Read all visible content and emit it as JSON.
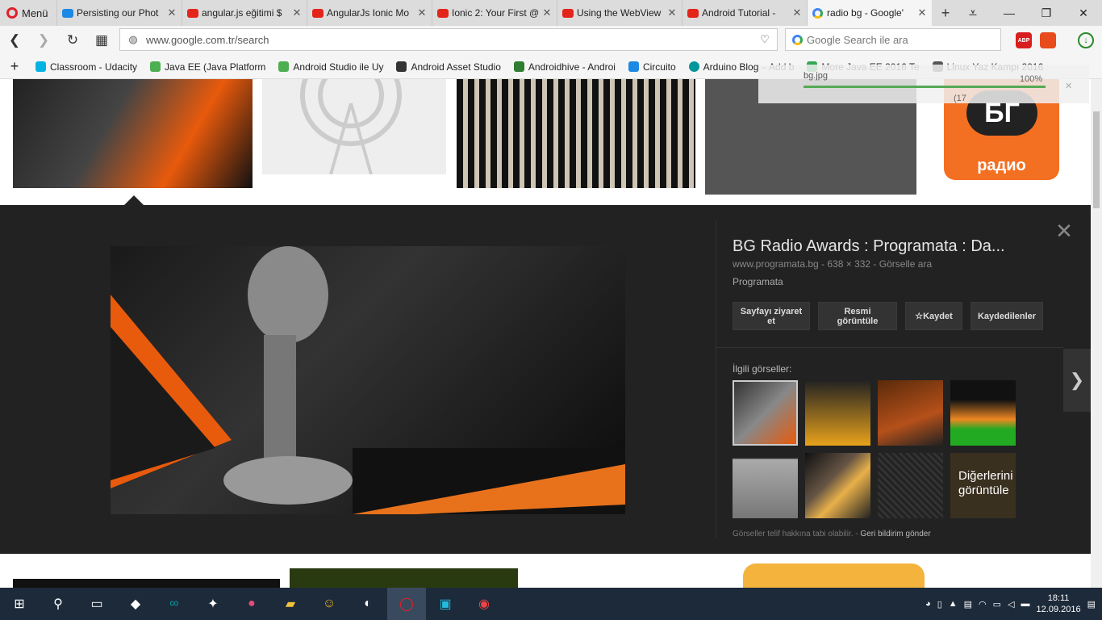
{
  "tabbar": {
    "menu_label": "Menü",
    "tabs": [
      {
        "title": "Persisting our Phot",
        "icon": "udacity-icon"
      },
      {
        "title": "angular.js eğitimi $",
        "icon": "youtube-icon"
      },
      {
        "title": "AngularJs Ionic Mo",
        "icon": "youtube-icon"
      },
      {
        "title": "Ionic 2: Your First @",
        "icon": "youtube-icon"
      },
      {
        "title": "Using the WebView",
        "icon": "youtube-icon"
      },
      {
        "title": "Android Tutorial -",
        "icon": "youtube-icon"
      },
      {
        "title": "radio bg - Google'",
        "icon": "google-icon",
        "active": true
      }
    ]
  },
  "address": {
    "url": "www.google.com.tr/search",
    "search_placeholder": "Google Search ile ara"
  },
  "bookmarks": [
    {
      "label": "Classroom - Udacity",
      "color": "#02b3e4"
    },
    {
      "label": "Java EE (Java Platform",
      "color": "#4caf50"
    },
    {
      "label": "Android Studio ile Uy",
      "color": "#4caf50"
    },
    {
      "label": "Android Asset Studio",
      "color": "#333333"
    },
    {
      "label": "Androidhive - Androi",
      "color": "#2e7d32"
    },
    {
      "label": "Circuito",
      "color": "#1e88e5"
    },
    {
      "label": "Arduino Blog – Add b",
      "color": "#00979c"
    },
    {
      "label": "More Java EE 2016 Te",
      "color": "#34a853"
    },
    {
      "label": "Linux Yaz Kampı 2016",
      "color": "#555555"
    }
  ],
  "download": {
    "file": "bg.jpg",
    "percent": "100%",
    "size": "(17"
  },
  "preview": {
    "title": "BG Radio Awards : Programata : Da...",
    "meta": "www.programata.bg - 638 × 332 - Görselle ara",
    "source": "Programata",
    "buttons": {
      "visit": "Sayfayı ziyaret et",
      "view": "Resmi görüntüle",
      "save": "Kaydet",
      "saved": "Kaydedilenler"
    },
    "related_label": "İlgili görseller:",
    "more_label": "Diğerlerini görüntüle",
    "footer_text": "Görseller telif hakkına tabi olabilir.",
    "footer_link": "Geri bildirim gönder"
  },
  "badge": {
    "line1": "БГ",
    "line2": "радио"
  },
  "clock": {
    "time": "18:11",
    "date": "12.09.2016"
  }
}
